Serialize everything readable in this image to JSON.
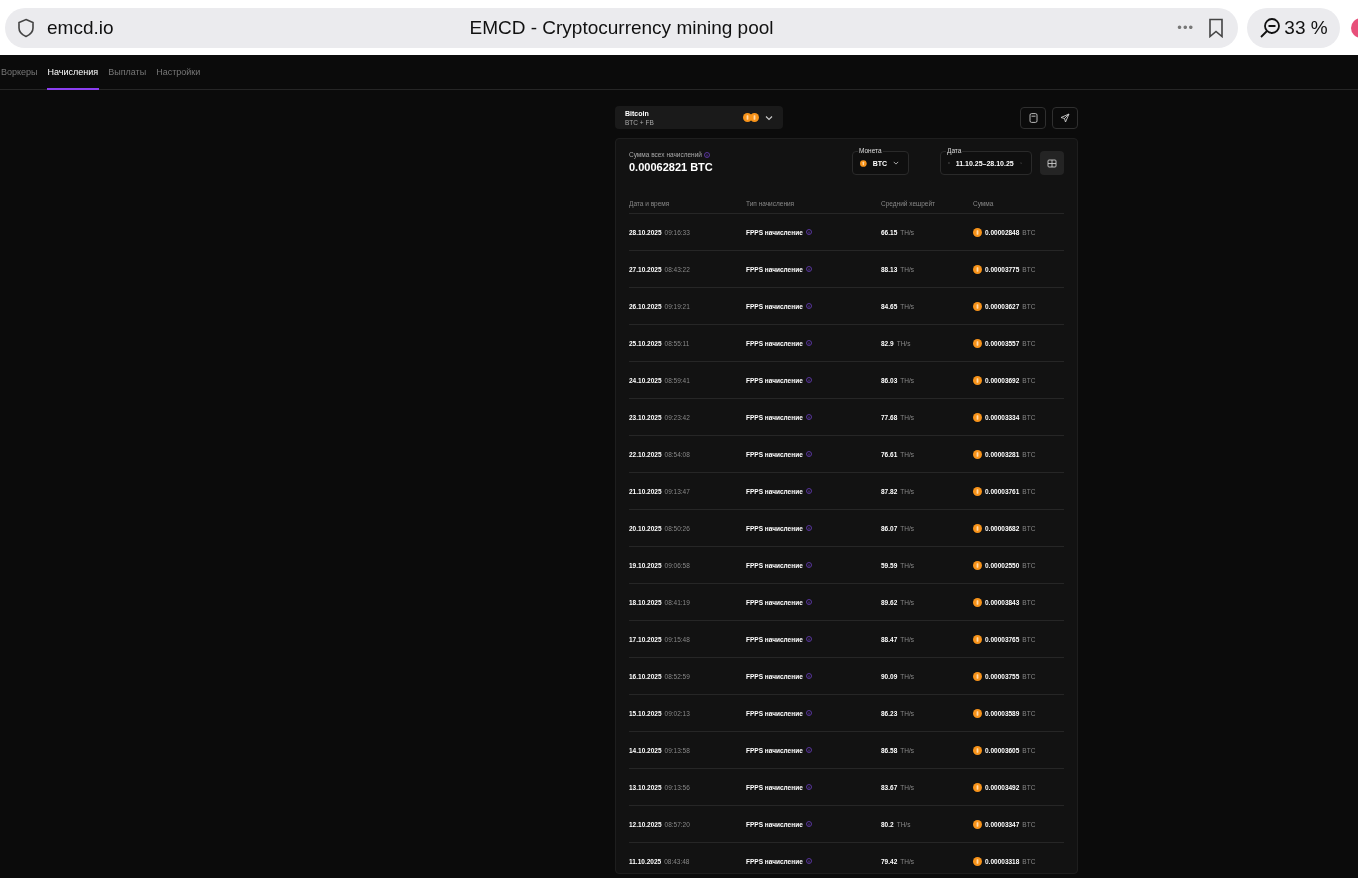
{
  "browser": {
    "address": "emcd.io",
    "title": "EMCD - Cryptocurrency mining pool",
    "menu": "•••",
    "zoom": "33 %"
  },
  "tabs": [
    {
      "label": "Воркеры",
      "selected": false
    },
    {
      "label": "Начисления",
      "selected": true
    },
    {
      "label": "Выплаты",
      "selected": false
    },
    {
      "label": "Настройки",
      "selected": false
    }
  ],
  "coin_selector": {
    "name": "Bitcoin",
    "subtitle": "BTC + FB"
  },
  "summary": {
    "label": "Сумма всех начислений",
    "value": "0.00062821 BTC"
  },
  "coin_filter": {
    "label": "Монета",
    "value": "BTC"
  },
  "date_filter": {
    "label": "Дата",
    "value": "11.10.25–28.10.25"
  },
  "table": {
    "columns": [
      "Дата и время",
      "Тип начисления",
      "Средний хешрейт",
      "Сумма"
    ],
    "rows": [
      {
        "date": "28.10.2025",
        "time": "09:16:33",
        "type": "FPPS начисление",
        "hashrate": "66.15",
        "hashrate_unit": "TH/s",
        "amount": "0.00002848",
        "currency": "BTC"
      },
      {
        "date": "27.10.2025",
        "time": "08:43:22",
        "type": "FPPS начисление",
        "hashrate": "88.13",
        "hashrate_unit": "TH/s",
        "amount": "0.00003775",
        "currency": "BTC"
      },
      {
        "date": "26.10.2025",
        "time": "09:19:21",
        "type": "FPPS начисление",
        "hashrate": "84.65",
        "hashrate_unit": "TH/s",
        "amount": "0.00003627",
        "currency": "BTC"
      },
      {
        "date": "25.10.2025",
        "time": "08:55:11",
        "type": "FPPS начисление",
        "hashrate": "82.9",
        "hashrate_unit": "TH/s",
        "amount": "0.00003557",
        "currency": "BTC"
      },
      {
        "date": "24.10.2025",
        "time": "08:59:41",
        "type": "FPPS начисление",
        "hashrate": "86.03",
        "hashrate_unit": "TH/s",
        "amount": "0.00003692",
        "currency": "BTC"
      },
      {
        "date": "23.10.2025",
        "time": "09:23:42",
        "type": "FPPS начисление",
        "hashrate": "77.68",
        "hashrate_unit": "TH/s",
        "amount": "0.00003334",
        "currency": "BTC"
      },
      {
        "date": "22.10.2025",
        "time": "08:54:08",
        "type": "FPPS начисление",
        "hashrate": "76.61",
        "hashrate_unit": "TH/s",
        "amount": "0.00003281",
        "currency": "BTC"
      },
      {
        "date": "21.10.2025",
        "time": "09:13:47",
        "type": "FPPS начисление",
        "hashrate": "87.82",
        "hashrate_unit": "TH/s",
        "amount": "0.00003761",
        "currency": "BTC"
      },
      {
        "date": "20.10.2025",
        "time": "08:50:26",
        "type": "FPPS начисление",
        "hashrate": "86.07",
        "hashrate_unit": "TH/s",
        "amount": "0.00003682",
        "currency": "BTC"
      },
      {
        "date": "19.10.2025",
        "time": "09:06:58",
        "type": "FPPS начисление",
        "hashrate": "59.59",
        "hashrate_unit": "TH/s",
        "amount": "0.00002550",
        "currency": "BTC"
      },
      {
        "date": "18.10.2025",
        "time": "08:41:19",
        "type": "FPPS начисление",
        "hashrate": "89.62",
        "hashrate_unit": "TH/s",
        "amount": "0.00003843",
        "currency": "BTC"
      },
      {
        "date": "17.10.2025",
        "time": "09:15:48",
        "type": "FPPS начисление",
        "hashrate": "88.47",
        "hashrate_unit": "TH/s",
        "amount": "0.00003765",
        "currency": "BTC"
      },
      {
        "date": "16.10.2025",
        "time": "08:52:59",
        "type": "FPPS начисление",
        "hashrate": "90.09",
        "hashrate_unit": "TH/s",
        "amount": "0.00003755",
        "currency": "BTC"
      },
      {
        "date": "15.10.2025",
        "time": "09:02:13",
        "type": "FPPS начисление",
        "hashrate": "86.23",
        "hashrate_unit": "TH/s",
        "amount": "0.00003589",
        "currency": "BTC"
      },
      {
        "date": "14.10.2025",
        "time": "09:13:58",
        "type": "FPPS начисление",
        "hashrate": "86.58",
        "hashrate_unit": "TH/s",
        "amount": "0.00003605",
        "currency": "BTC"
      },
      {
        "date": "13.10.2025",
        "time": "09:13:56",
        "type": "FPPS начисление",
        "hashrate": "83.67",
        "hashrate_unit": "TH/s",
        "amount": "0.00003492",
        "currency": "BTC"
      },
      {
        "date": "12.10.2025",
        "time": "08:57:20",
        "type": "FPPS начисление",
        "hashrate": "80.2",
        "hashrate_unit": "TH/s",
        "amount": "0.00003347",
        "currency": "BTC"
      },
      {
        "date": "11.10.2025",
        "time": "08:43:48",
        "type": "FPPS начисление",
        "hashrate": "79.42",
        "hashrate_unit": "TH/s",
        "amount": "0.00003318",
        "currency": "BTC"
      }
    ]
  }
}
